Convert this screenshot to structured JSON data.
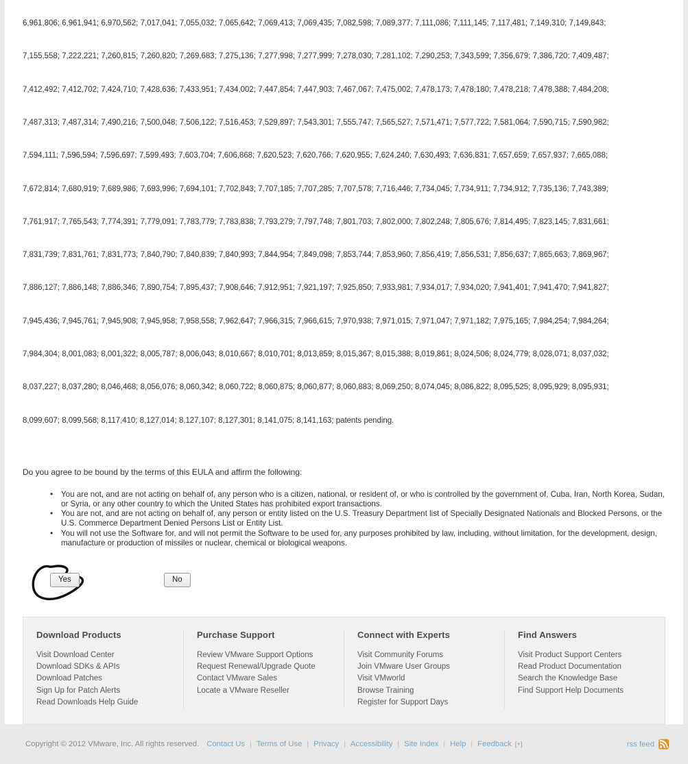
{
  "patents": {
    "lines": [
      "6,961,806; 6,961,941; 6,970,562; 7,017,041; 7,055,032; 7,065,642; 7,069,413; 7,069,435; 7,082,598; 7,089,377; 7,111,086; 7,111,145; 7,117,481; 7,149,310; 7,149,843;",
      "7,155,558; 7,222,221; 7,260,815; 7,260,820; 7,269,683; 7,275,136; 7,277,998; 7,277,999; 7,278,030; 7,281,102; 7,290,253; 7,343,599; 7,356,679; 7,386,720; 7,409,487;",
      "7,412,492; 7,412,702; 7,424,710; 7,428,636; 7,433,951; 7,434,002; 7,447,854; 7,447,903; 7,467,067; 7,475,002; 7,478,173; 7,478,180; 7,478,218; 7,478,388; 7,484,208;",
      "7,487,313; 7,487,314; 7,490,216; 7,500,048; 7,506,122; 7,516,453; 7,529,897; 7,543,301; 7,555,747; 7,565,527; 7,571,471; 7,577,722; 7,581,064; 7,590,715; 7,590,982;",
      "7,594,111; 7,596,594; 7,596,697; 7,599,493; 7,603,704; 7,606,868; 7,620,523; 7,620,766; 7,620,955; 7,624,240; 7,630,493; 7,636,831; 7,657,659; 7,657,937; 7,665,088;",
      "7,672,814; 7,680,919; 7,689,986; 7,693,996; 7,694,101; 7,702,843; 7,707,185; 7,707,285; 7,707,578; 7,716,446; 7,734,045; 7,734,911; 7,734,912; 7,735,136; 7,743,389;",
      "7,761,917; 7,765,543; 7,774,391; 7,779,091; 7,783,779; 7,783,838; 7,793,279; 7,797,748; 7,801,703; 7,802,000; 7,802,248; 7,805,676; 7,814,495; 7,823,145; 7,831,661;",
      "7,831,739; 7,831,761; 7,831,773; 7,840,790; 7,840,839; 7,840,993; 7,844,954; 7,849,098; 7,853,744; 7,853,960; 7,856,419; 7,856,531; 7,856,637; 7,865,663; 7,869,967;",
      "7,886,127; 7,886,148; 7,886,346; 7,890,754; 7,895,437; 7,908,646; 7,912,951; 7,921,197; 7,925,850; 7,933,981; 7,934,017; 7,934,020; 7,941,401; 7,941,470; 7,941,827;",
      "7,945,436; 7,945,761; 7,945,908; 7,945,958; 7,958,558; 7,962,647; 7,966,315; 7,966,615; 7,970,938; 7,971,015; 7,971,047; 7,971,182; 7,975,165; 7,984,254; 7,984,264;",
      "7,984,304; 8,001,083; 8,001,322; 8,005,787; 8,006,043; 8,010,667; 8,010,701; 8,013,859; 8,015,367; 8,015,388; 8,019,861; 8,024,506; 8,024,779; 8,028,071; 8,037,032;",
      "8,037,227; 8,037,280; 8,046,468; 8,056,076; 8,060,342; 8,060,722; 8,060,875; 8,060,877; 8,060,883; 8,069,250; 8,074,045; 8,086,822; 8,095,525; 8,095,929; 8,095,931;",
      "8,099,607; 8,099,568; 8,117,410; 8,127,014; 8,127,107; 8,127,301; 8,141,075; 8,141,163; patents pending."
    ]
  },
  "eula": {
    "question": "Do you agree to be bound by the terms of this EULA and affirm the following:",
    "affirmations": [
      "You are not, and are not acting on behalf of, any person who is a citizen, national, or resident of, or who is controlled by the government of, Cuba, Iran, North Korea, Sudan, or Syria, or any other country to which the United States has prohibited export transactions.",
      "You are not, and are not acting on behalf of, any person or entity listed on the U.S. Treasury Department list of Specially Designated Nationals and Blocked Persons, or the U.S. Commerce Department Denied Persons List or Entity List.",
      "You will not use the Software for, and will not permit the Software to be used for, any purposes prohibited by law, including, without limitation, for the development, design, manufacture or production of missiles or nuclear, chemical or biological weapons."
    ],
    "yes_label": "Yes",
    "no_label": "No",
    "annotation": {
      "name": "hand-drawn-circle-around-yes",
      "color": "#000000"
    }
  },
  "footer": {
    "columns": [
      {
        "heading": "Download Products",
        "links": [
          "Visit Download Center",
          "Download SDKs & APIs",
          "Download Patches",
          "Sign Up for Patch Alerts",
          "Read Downloads Help Guide"
        ]
      },
      {
        "heading": "Purchase Support",
        "links": [
          "Review VMware Support Options",
          "Request Renewal/Upgrade Quote",
          "Contact VMware Sales",
          "Locate a VMware Reseller"
        ]
      },
      {
        "heading": "Connect with Experts",
        "links": [
          "Visit Community Forums",
          "Join VMware User Groups",
          "Visit VMworld",
          "Browse Training",
          "Register for Support Days"
        ]
      },
      {
        "heading": "Find Answers",
        "links": [
          "Visit Product Support Centers",
          "Read Product Documentation",
          "Search the Knowledge Base",
          "Find Support Help Documents"
        ]
      }
    ]
  },
  "copyright": {
    "text": "Copyright © 2012 VMware, Inc. All rights reserved.",
    "links": [
      "Contact Us",
      "Terms of Use",
      "Privacy",
      "Accessibility",
      "Site Index",
      "Help",
      "Feedback"
    ],
    "separator": "|",
    "feedback_plus": "[+]",
    "rss_label": "rss feed",
    "rss_icon_color": "#e98b1a",
    "link_color": "#7aa6c7"
  }
}
